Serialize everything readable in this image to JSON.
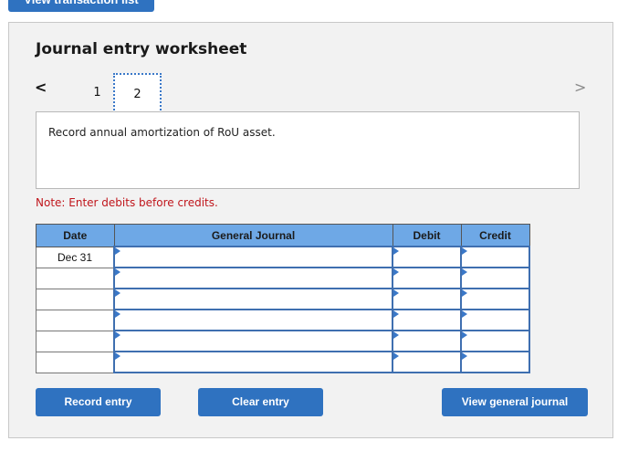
{
  "top_button": {
    "label": "View transaction list"
  },
  "worksheet": {
    "title": "Journal entry worksheet",
    "nav": {
      "prev_icon": "chevron-left-icon",
      "prev_glyph": "<",
      "next_icon": "chevron-right-icon",
      "next_glyph": ">"
    },
    "tabs": [
      {
        "label": "1",
        "active": false
      },
      {
        "label": "2",
        "active": true
      }
    ],
    "description": "Record annual amortization of RoU asset.",
    "note": "Note: Enter debits before credits.",
    "table": {
      "headers": [
        "Date",
        "General Journal",
        "Debit",
        "Credit"
      ],
      "rows": [
        {
          "date": "Dec 31",
          "account": "",
          "debit": "",
          "credit": ""
        },
        {
          "date": "",
          "account": "",
          "debit": "",
          "credit": ""
        },
        {
          "date": "",
          "account": "",
          "debit": "",
          "credit": ""
        },
        {
          "date": "",
          "account": "",
          "debit": "",
          "credit": ""
        },
        {
          "date": "",
          "account": "",
          "debit": "",
          "credit": ""
        },
        {
          "date": "",
          "account": "",
          "debit": "",
          "credit": ""
        }
      ]
    },
    "buttons": {
      "record": "Record entry",
      "clear": "Clear entry",
      "view_journal": "View general journal"
    }
  },
  "colors": {
    "accent": "#2f72c0",
    "header": "#6ea8e6",
    "note": "#c0161c",
    "panel": "#f2f2f2"
  }
}
